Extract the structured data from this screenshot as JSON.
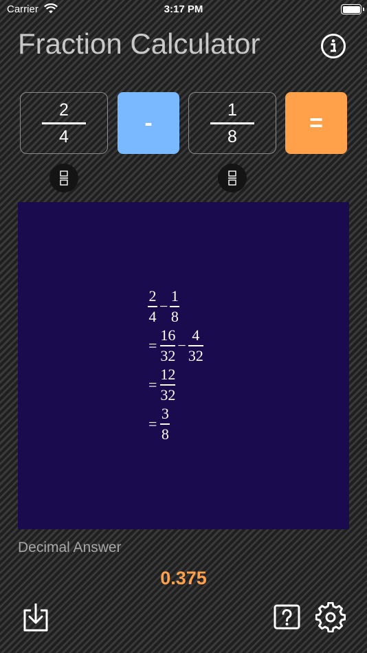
{
  "status_bar": {
    "carrier": "Carrier",
    "time": "3:17 PM"
  },
  "app": {
    "title": "Fraction Calculator"
  },
  "input": {
    "left": {
      "numerator": "2",
      "denominator": "4"
    },
    "operator": "-",
    "right": {
      "numerator": "1",
      "denominator": "8"
    },
    "equals": "="
  },
  "work": {
    "line1": {
      "a": {
        "n": "2",
        "d": "4"
      },
      "op": "−",
      "b": {
        "n": "1",
        "d": "8"
      }
    },
    "line2": {
      "eq": "=",
      "a": {
        "n": "16",
        "d": "32"
      },
      "op": "−",
      "b": {
        "n": "4",
        "d": "32"
      }
    },
    "line3": {
      "eq": "=",
      "a": {
        "n": "12",
        "d": "32"
      }
    },
    "line4": {
      "eq": "=",
      "a": {
        "n": "3",
        "d": "8"
      }
    }
  },
  "result": {
    "label": "Decimal Answer",
    "value": "0.375"
  },
  "colors": {
    "operator_bg": "#7ab8ff",
    "equals_bg": "#ffa04a",
    "panel_bg": "#190b4d",
    "result_text": "#ffa04a"
  },
  "icons": [
    "wifi-icon",
    "battery-icon",
    "info-icon",
    "fraction-icon",
    "save-icon",
    "help-icon",
    "gear-icon"
  ]
}
